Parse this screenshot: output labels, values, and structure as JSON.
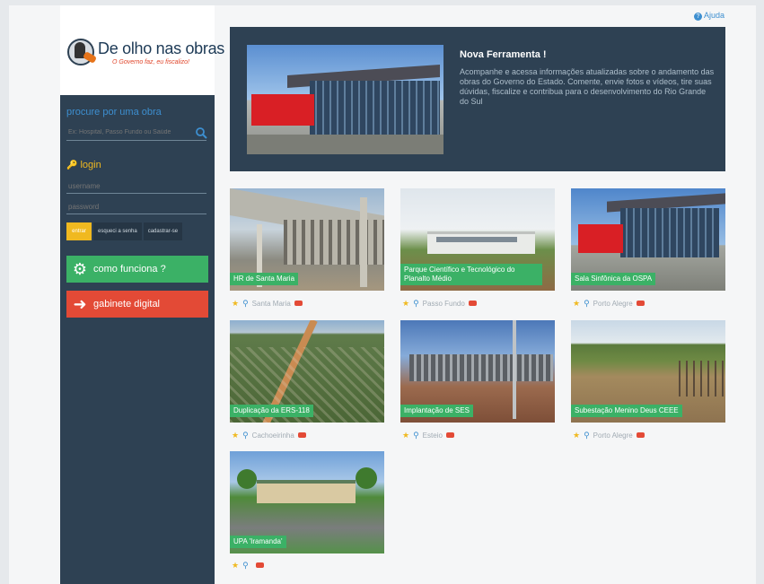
{
  "header": {
    "help_label": "Ajuda",
    "help_icon": "question-circle-icon"
  },
  "sidebar": {
    "logo_title": "De olho nas obras",
    "logo_tagline": "O Governo faz, eu fiscalizo!",
    "search_label": "procure por uma obra",
    "search_placeholder": "Ex: Hospital, Passo Fundo ou Saúde",
    "login_label": "login",
    "username_placeholder": "username",
    "password_placeholder": "password",
    "buttons": {
      "enter": "entrar",
      "forgot": "esqueci a senha",
      "register": "cadastrar-se"
    },
    "how_it_works": "como funciona ?",
    "digital_cabinet": "gabinete digital"
  },
  "feature": {
    "title": "Nova Ferramenta !",
    "text": "Acompanhe e acessa informações atualizadas sobre o andamento das obras do Governo do Estado. Comente, envie fotos e vídeos, tire suas dúvidas, fiscalize e contribua para o desenvolvimento do Rio Grande do Sul"
  },
  "cards": [
    {
      "label": "HR de Santa Maria",
      "city": "Santa Maria"
    },
    {
      "label": "Parque Científico e Tecnológico do Planalto Médio",
      "city": "Passo Fundo"
    },
    {
      "label": "Sala Sinfônica da OSPA",
      "city": "Porto Alegre"
    },
    {
      "label": "Duplicação da ERS-118",
      "city": "Cachoeirinha"
    },
    {
      "label": "Implantação de SES",
      "city": "Esteio"
    },
    {
      "label": "Subestação Menino Deus CEEE",
      "city": "Porto Alegre"
    },
    {
      "label": "UPA 'Iramanda'",
      "city": ""
    }
  ],
  "colors": {
    "sidebar": "#2e4153",
    "accent_green": "#3bb166",
    "accent_red": "#e34a36",
    "accent_yellow": "#f0b920",
    "link_blue": "#3d8fd0"
  }
}
